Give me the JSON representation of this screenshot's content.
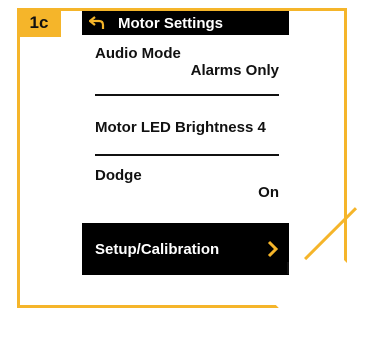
{
  "step_badge": "1c",
  "header": {
    "title": "Motor Settings",
    "back_icon": "back-arrow-icon"
  },
  "settings": [
    {
      "label": "Audio Mode",
      "value": "Alarms Only"
    },
    {
      "label": "Motor LED Brightness 4",
      "value": ""
    },
    {
      "label": "Dodge",
      "value": "On"
    }
  ],
  "selected_item": {
    "label": "Setup/Calibration",
    "icon": "chevron-right-icon"
  },
  "colors": {
    "accent": "#f5b52a",
    "screen_bg": "#ffffff",
    "selected_bg": "#000000"
  }
}
